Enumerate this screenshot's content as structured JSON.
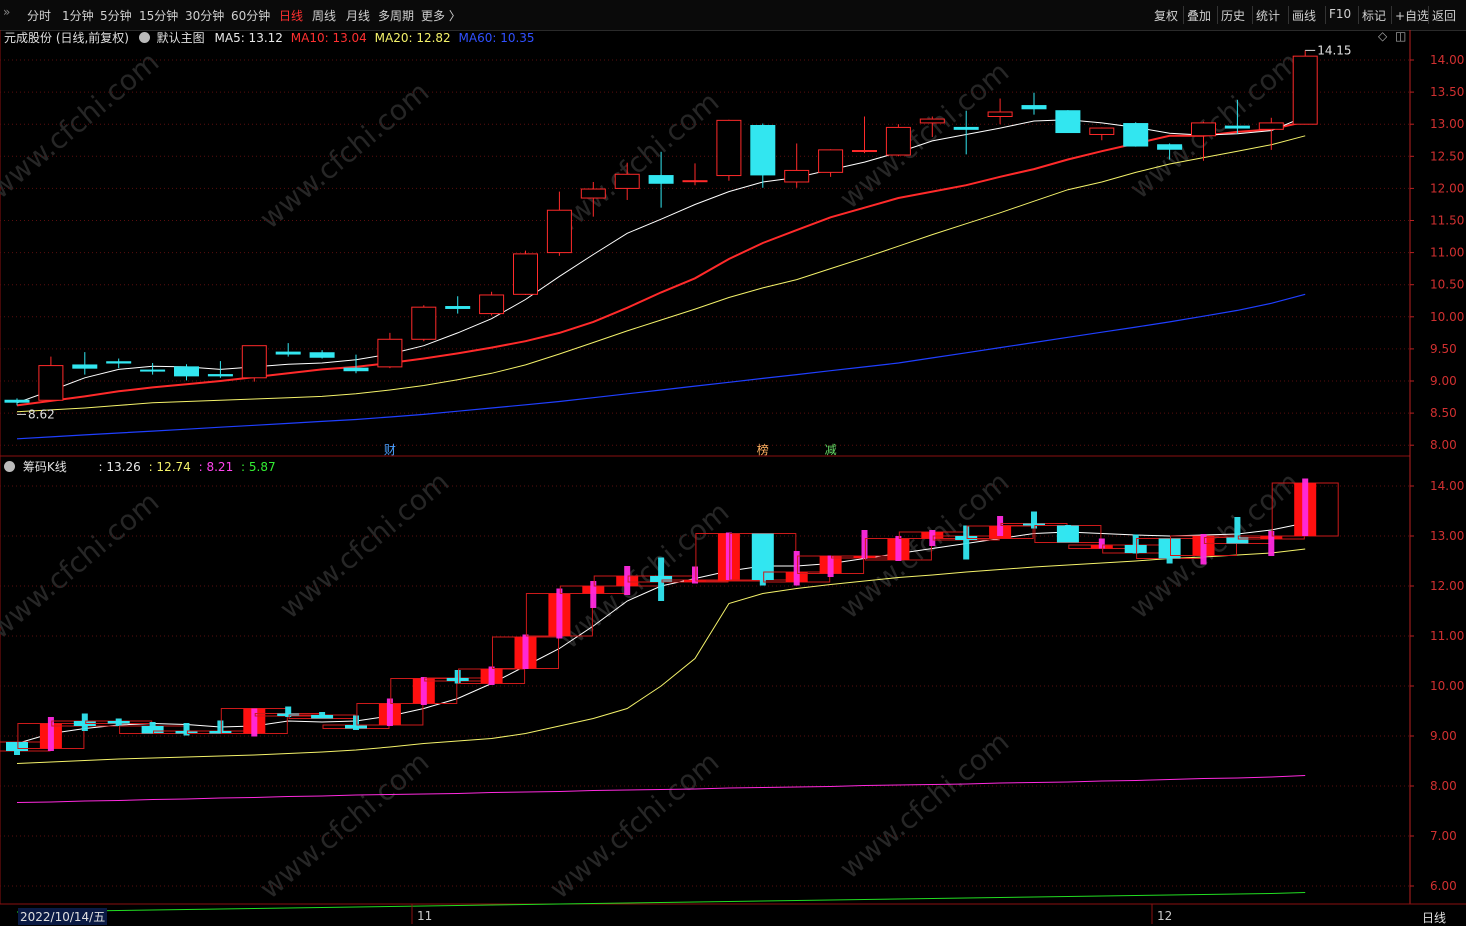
{
  "toolbar": {
    "left": [
      "分时",
      "1分钟",
      "5分钟",
      "15分钟",
      "30分钟",
      "60分钟",
      "日线",
      "周线",
      "月线",
      "多周期",
      "更多 〉"
    ],
    "active": "日线",
    "right": [
      "复权",
      "叠加",
      "历史",
      "统计",
      "画线",
      "F10",
      "标记",
      "+自选",
      "返回"
    ]
  },
  "main": {
    "stock": "元成股份 (日线,前复权)",
    "template": "默认主图",
    "ma5": "MA5: 13.12",
    "ma10": "MA10: 13.04",
    "ma20": "MA20: 12.82",
    "ma60": "MA60: 10.35",
    "high_label": "14.15",
    "low_label": "8.62",
    "events": [
      {
        "idx": 11,
        "text": "财",
        "color": "#4aa0ff"
      },
      {
        "idx": 22,
        "text": "榜",
        "color": "#ffb060"
      },
      {
        "idx": 24,
        "text": "减",
        "color": "#66dd66"
      }
    ],
    "y_ticks": [
      "14.00",
      "13.50",
      "13.00",
      "12.50",
      "12.00",
      "11.50",
      "11.00",
      "10.50",
      "10.00",
      "9.50",
      "9.00",
      "8.50",
      "8.00"
    ]
  },
  "sub": {
    "name": "筹码K线",
    "v1": ": 13.26",
    "v2": ": 12.74",
    "v3": ": 8.21",
    "v4": ": 5.87",
    "y_ticks": [
      "14.00",
      "13.00",
      "12.00",
      "11.00",
      "10.00",
      "9.00",
      "8.00",
      "7.00",
      "6.00"
    ]
  },
  "bottom": {
    "date": "2022/10/14/五",
    "m11": "11",
    "m12": "12",
    "period": "日线"
  },
  "colors": {
    "up": "#ff2a2a",
    "down": "#32e6f0",
    "ma5": "#ffffff",
    "ma10": "#ff2a2a",
    "ma20": "#f4f26a",
    "ma60": "#1f3fff",
    "chip_pink": "#ff2adf",
    "chip_green": "#22dd22",
    "axis": "#b82020"
  },
  "chart_data": [
    {
      "type": "candlestick",
      "title": "元成股份 (日线,前复权)",
      "dates_start": "2022/10/14",
      "ylim": [
        7.9,
        14.4
      ],
      "ohlc": [
        [
          8.7,
          8.73,
          8.62,
          8.67
        ],
        [
          8.7,
          9.38,
          8.7,
          9.24
        ],
        [
          9.25,
          9.45,
          9.1,
          9.2
        ],
        [
          9.3,
          9.35,
          9.2,
          9.28
        ],
        [
          9.17,
          9.28,
          9.1,
          9.16
        ],
        [
          9.22,
          9.26,
          9.01,
          9.08
        ],
        [
          9.1,
          9.31,
          9.05,
          9.08
        ],
        [
          9.05,
          9.55,
          8.99,
          9.55
        ],
        [
          9.45,
          9.59,
          9.38,
          9.42
        ],
        [
          9.44,
          9.48,
          9.35,
          9.37
        ],
        [
          9.2,
          9.41,
          9.12,
          9.16
        ],
        [
          9.22,
          9.75,
          9.2,
          9.65
        ],
        [
          9.65,
          10.18,
          9.62,
          10.15
        ],
        [
          10.16,
          10.32,
          10.05,
          10.13
        ],
        [
          10.05,
          10.39,
          10.02,
          10.34
        ],
        [
          10.35,
          11.03,
          10.34,
          10.98
        ],
        [
          11.0,
          11.95,
          10.95,
          11.66
        ],
        [
          11.85,
          12.1,
          11.56,
          11.99
        ],
        [
          12.0,
          12.4,
          11.82,
          12.22
        ],
        [
          12.2,
          12.57,
          11.7,
          12.08
        ],
        [
          12.12,
          12.39,
          12.05,
          12.12
        ],
        [
          12.2,
          13.07,
          12.12,
          13.06
        ],
        [
          12.98,
          13.01,
          12.01,
          12.21
        ],
        [
          12.1,
          12.7,
          12.01,
          12.28
        ],
        [
          12.25,
          12.61,
          12.18,
          12.6
        ],
        [
          12.58,
          13.12,
          12.55,
          12.59
        ],
        [
          12.52,
          13.0,
          12.5,
          12.95
        ],
        [
          13.02,
          13.12,
          12.8,
          13.08
        ],
        [
          12.95,
          13.21,
          12.53,
          12.92
        ],
        [
          13.12,
          13.4,
          13.0,
          13.19
        ],
        [
          13.29,
          13.49,
          13.15,
          13.24
        ],
        [
          13.21,
          13.22,
          12.87,
          12.87
        ],
        [
          12.84,
          12.95,
          12.75,
          12.94
        ],
        [
          13.01,
          13.03,
          12.65,
          12.66
        ],
        [
          12.68,
          12.7,
          12.45,
          12.61
        ],
        [
          12.82,
          13.04,
          12.43,
          13.02
        ],
        [
          12.97,
          13.38,
          12.85,
          12.94
        ],
        [
          12.92,
          13.1,
          12.6,
          13.02
        ],
        [
          13.0,
          14.15,
          13.0,
          14.06
        ]
      ],
      "ma5": [
        8.66,
        8.85,
        9.05,
        9.18,
        9.23,
        9.22,
        9.18,
        9.22,
        9.26,
        9.28,
        9.33,
        9.42,
        9.55,
        9.75,
        9.97,
        10.27,
        10.63,
        10.97,
        11.3,
        11.52,
        11.75,
        11.95,
        12.1,
        12.17,
        12.29,
        12.41,
        12.56,
        12.74,
        12.84,
        12.94,
        13.05,
        13.07,
        13.02,
        12.95,
        12.86,
        12.83,
        12.85,
        12.9,
        13.12
      ],
      "ma10": [
        8.62,
        8.69,
        8.76,
        8.84,
        8.9,
        8.95,
        9.0,
        9.06,
        9.12,
        9.18,
        9.22,
        9.28,
        9.35,
        9.43,
        9.52,
        9.62,
        9.75,
        9.92,
        10.14,
        10.38,
        10.6,
        10.9,
        11.15,
        11.35,
        11.55,
        11.7,
        11.85,
        11.95,
        12.05,
        12.18,
        12.3,
        12.45,
        12.58,
        12.7,
        12.82,
        12.82,
        12.88,
        12.92,
        13.04
      ],
      "ma20": [
        8.52,
        8.55,
        8.58,
        8.62,
        8.66,
        8.68,
        8.7,
        8.72,
        8.74,
        8.76,
        8.8,
        8.86,
        8.93,
        9.02,
        9.12,
        9.25,
        9.42,
        9.6,
        9.78,
        9.95,
        10.12,
        10.3,
        10.45,
        10.58,
        10.75,
        10.92,
        11.1,
        11.28,
        11.45,
        11.62,
        11.8,
        11.98,
        12.1,
        12.25,
        12.38,
        12.48,
        12.58,
        12.68,
        12.82
      ],
      "ma60": [
        8.1,
        8.13,
        8.16,
        8.19,
        8.22,
        8.25,
        8.28,
        8.31,
        8.34,
        8.37,
        8.4,
        8.44,
        8.48,
        8.53,
        8.58,
        8.63,
        8.68,
        8.74,
        8.8,
        8.86,
        8.92,
        8.98,
        9.04,
        9.1,
        9.16,
        9.22,
        9.28,
        9.36,
        9.44,
        9.52,
        9.6,
        9.68,
        9.76,
        9.84,
        9.92,
        10.01,
        10.1,
        10.21,
        10.35
      ]
    },
    {
      "type": "chip-kline",
      "title": "筹码K线",
      "ylim": [
        5.7,
        14.6
      ],
      "blocks": [
        [
          8.7,
          8.88
        ],
        [
          8.75,
          9.25
        ],
        [
          9.2,
          9.3
        ],
        [
          9.25,
          9.3
        ],
        [
          9.05,
          9.2
        ],
        [
          9.05,
          9.1
        ],
        [
          9.05,
          9.1
        ],
        [
          9.05,
          9.55
        ],
        [
          9.4,
          9.45
        ],
        [
          9.35,
          9.42
        ],
        [
          9.15,
          9.22
        ],
        [
          9.22,
          9.65
        ],
        [
          9.65,
          10.15
        ],
        [
          10.1,
          10.16
        ],
        [
          10.05,
          10.34
        ],
        [
          10.35,
          10.98
        ],
        [
          11.0,
          11.85
        ],
        [
          11.85,
          12.0
        ],
        [
          12.0,
          12.2
        ],
        [
          12.08,
          12.2
        ],
        [
          12.08,
          12.12
        ],
        [
          12.1,
          13.05
        ],
        [
          12.12,
          13.05
        ],
        [
          12.08,
          12.28
        ],
        [
          12.25,
          12.6
        ],
        [
          12.58,
          12.6
        ],
        [
          12.52,
          12.95
        ],
        [
          12.95,
          13.08
        ],
        [
          12.92,
          13.0
        ],
        [
          12.95,
          13.2
        ],
        [
          13.22,
          13.25
        ],
        [
          12.87,
          13.21
        ],
        [
          12.75,
          12.82
        ],
        [
          12.66,
          12.82
        ],
        [
          12.55,
          12.95
        ],
        [
          12.61,
          13.0
        ],
        [
          12.85,
          12.97
        ],
        [
          12.94,
          13.0
        ],
        [
          13.0,
          14.06
        ]
      ],
      "line1": [
        8.85,
        9.05,
        9.15,
        9.22,
        9.25,
        9.23,
        9.18,
        9.2,
        9.3,
        9.28,
        9.3,
        9.4,
        9.55,
        9.75,
        10.05,
        10.4,
        10.75,
        11.2,
        11.7,
        12.0,
        12.15,
        12.3,
        12.4,
        12.4,
        12.45,
        12.55,
        12.65,
        12.75,
        12.85,
        12.95,
        13.05,
        13.08,
        13.05,
        13.02,
        13.0,
        13.02,
        13.04,
        13.12,
        13.26
      ],
      "line2": [
        8.45,
        8.48,
        8.51,
        8.54,
        8.56,
        8.58,
        8.6,
        8.62,
        8.65,
        8.68,
        8.72,
        8.78,
        8.85,
        8.9,
        8.95,
        9.05,
        9.2,
        9.35,
        9.55,
        10.0,
        10.55,
        11.65,
        11.85,
        11.95,
        12.03,
        12.1,
        12.17,
        12.22,
        12.28,
        12.33,
        12.38,
        12.42,
        12.46,
        12.5,
        12.55,
        12.58,
        12.62,
        12.66,
        12.74
      ],
      "line3": [
        7.67,
        7.68,
        7.7,
        7.71,
        7.73,
        7.74,
        7.76,
        7.77,
        7.79,
        7.8,
        7.82,
        7.83,
        7.84,
        7.85,
        7.87,
        7.88,
        7.89,
        7.91,
        7.92,
        7.93,
        7.94,
        7.96,
        7.97,
        7.98,
        7.99,
        8.01,
        8.02,
        8.03,
        8.04,
        8.06,
        8.07,
        8.08,
        8.1,
        8.11,
        8.13,
        8.15,
        8.16,
        8.18,
        8.21
      ],
      "line4": [
        5.48,
        5.49,
        5.5,
        5.51,
        5.52,
        5.53,
        5.54,
        5.55,
        5.56,
        5.57,
        5.58,
        5.59,
        5.6,
        5.61,
        5.62,
        5.63,
        5.64,
        5.65,
        5.66,
        5.67,
        5.68,
        5.69,
        5.7,
        5.71,
        5.72,
        5.73,
        5.74,
        5.75,
        5.76,
        5.77,
        5.78,
        5.79,
        5.8,
        5.81,
        5.82,
        5.83,
        5.84,
        5.85,
        5.87
      ]
    }
  ]
}
